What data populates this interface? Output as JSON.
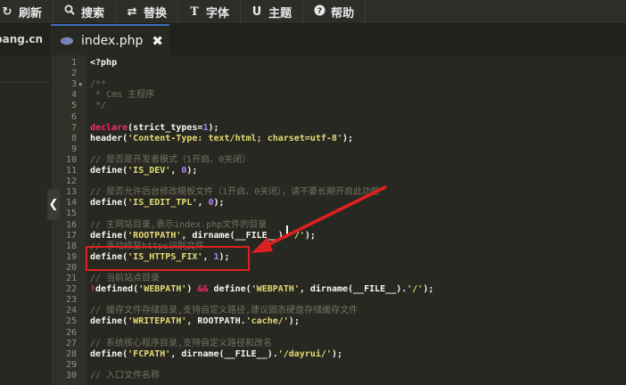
{
  "toolbar": {
    "refresh": "刷新",
    "search": "搜索",
    "replace": "替换",
    "font": "字体",
    "theme": "主题",
    "help": "帮助"
  },
  "tabs": {
    "side_label": "pang.cn",
    "file_name": "index.php",
    "close_glyph": "✖"
  },
  "sidebar": {
    "collapse_glyph": "❮"
  },
  "editor": {
    "lines": [
      {
        "n": "1",
        "fold": "",
        "parts": [
          {
            "t": "<?php",
            "c": "f"
          }
        ]
      },
      {
        "n": "2",
        "fold": "",
        "parts": []
      },
      {
        "n": "3",
        "fold": "▼",
        "parts": [
          {
            "t": "/**",
            "c": "c"
          }
        ]
      },
      {
        "n": "4",
        "fold": "",
        "parts": [
          {
            "t": " * Cms 主程序",
            "c": "c"
          }
        ]
      },
      {
        "n": "5",
        "fold": "",
        "parts": [
          {
            "t": " */",
            "c": "c"
          }
        ]
      },
      {
        "n": "6",
        "fold": "",
        "parts": []
      },
      {
        "n": "7",
        "fold": "",
        "parts": [
          {
            "t": "declare",
            "c": "k"
          },
          {
            "t": "(strict_types=",
            "c": "f"
          },
          {
            "t": "1",
            "c": "n"
          },
          {
            "t": ");",
            "c": "f"
          }
        ]
      },
      {
        "n": "8",
        "fold": "",
        "parts": [
          {
            "t": "header(",
            "c": "f"
          },
          {
            "t": "'Content-Type: text/html; charset=utf-8'",
            "c": "s"
          },
          {
            "t": ");",
            "c": "f"
          }
        ]
      },
      {
        "n": "9",
        "fold": "",
        "parts": []
      },
      {
        "n": "10",
        "fold": "",
        "parts": [
          {
            "t": "// 是否是开发者模式（1开启、0关闭）",
            "c": "c"
          }
        ]
      },
      {
        "n": "11",
        "fold": "",
        "parts": [
          {
            "t": "define(",
            "c": "f"
          },
          {
            "t": "'IS_DEV'",
            "c": "s"
          },
          {
            "t": ", ",
            "c": "f"
          },
          {
            "t": "0",
            "c": "n"
          },
          {
            "t": ");",
            "c": "f"
          }
        ]
      },
      {
        "n": "12",
        "fold": "",
        "parts": []
      },
      {
        "n": "13",
        "fold": "",
        "parts": [
          {
            "t": "// 是否允许后台修改模板文件（1开启、0关闭），请不要长期开启此功能",
            "c": "c"
          }
        ]
      },
      {
        "n": "14",
        "fold": "",
        "parts": [
          {
            "t": "define(",
            "c": "f"
          },
          {
            "t": "'IS_EDIT_TPL'",
            "c": "s"
          },
          {
            "t": ", ",
            "c": "f"
          },
          {
            "t": "0",
            "c": "n"
          },
          {
            "t": ");",
            "c": "f"
          }
        ]
      },
      {
        "n": "15",
        "fold": "",
        "parts": []
      },
      {
        "n": "16",
        "fold": "",
        "parts": [
          {
            "t": "// 主网站目录,表示index.php文件的目录",
            "c": "c"
          }
        ]
      },
      {
        "n": "17",
        "fold": "",
        "parts": [
          {
            "t": "define(",
            "c": "f"
          },
          {
            "t": "'ROOTPATH'",
            "c": "s"
          },
          {
            "t": ", dirname(__FILE__).",
            "c": "f"
          },
          {
            "t": "'/'",
            "c": "s"
          },
          {
            "t": ");",
            "c": "f"
          }
        ]
      },
      {
        "n": "18",
        "fold": "",
        "parts": [
          {
            "t": "// 手动修复https识别文件",
            "c": "c"
          }
        ]
      },
      {
        "n": "19",
        "fold": "",
        "parts": [
          {
            "t": "define(",
            "c": "f"
          },
          {
            "t": "'IS_HTTPS_FIX'",
            "c": "s"
          },
          {
            "t": ", ",
            "c": "f"
          },
          {
            "t": "1",
            "c": "n"
          },
          {
            "t": ");",
            "c": "f"
          }
        ]
      },
      {
        "n": "20",
        "fold": "",
        "parts": []
      },
      {
        "n": "21",
        "fold": "",
        "parts": [
          {
            "t": "// 当前站点目录",
            "c": "c"
          }
        ]
      },
      {
        "n": "22",
        "fold": "",
        "parts": [
          {
            "t": "!",
            "c": "k"
          },
          {
            "t": "defined(",
            "c": "f"
          },
          {
            "t": "'WEBPATH'",
            "c": "s"
          },
          {
            "t": ") ",
            "c": "f"
          },
          {
            "t": "&&",
            "c": "k"
          },
          {
            "t": " define(",
            "c": "f"
          },
          {
            "t": "'WEBPATH'",
            "c": "s"
          },
          {
            "t": ", dirname(__FILE__).",
            "c": "f"
          },
          {
            "t": "'/'",
            "c": "s"
          },
          {
            "t": ");",
            "c": "f"
          }
        ]
      },
      {
        "n": "23",
        "fold": "",
        "parts": []
      },
      {
        "n": "24",
        "fold": "",
        "parts": [
          {
            "t": "// 缓存文件存储目录,支持自定义路径,建议固态硬盘存储缓存文件",
            "c": "c"
          }
        ]
      },
      {
        "n": "25",
        "fold": "",
        "parts": [
          {
            "t": "define(",
            "c": "f"
          },
          {
            "t": "'WRITEPATH'",
            "c": "s"
          },
          {
            "t": ", ROOTPATH.",
            "c": "f"
          },
          {
            "t": "'cache/'",
            "c": "s"
          },
          {
            "t": ");",
            "c": "f"
          }
        ]
      },
      {
        "n": "26",
        "fold": "",
        "parts": []
      },
      {
        "n": "27",
        "fold": "",
        "parts": [
          {
            "t": "// 系统核心程序目录,支持自定义路径和改名",
            "c": "c"
          }
        ]
      },
      {
        "n": "28",
        "fold": "",
        "parts": [
          {
            "t": "define(",
            "c": "f"
          },
          {
            "t": "'FCPATH'",
            "c": "s"
          },
          {
            "t": ", dirname(__FILE__).",
            "c": "f"
          },
          {
            "t": "'/dayrui/'",
            "c": "s"
          },
          {
            "t": ");",
            "c": "f"
          }
        ]
      },
      {
        "n": "29",
        "fold": "",
        "parts": []
      },
      {
        "n": "30",
        "fold": "",
        "parts": [
          {
            "t": "// 入口文件名称",
            "c": "c"
          }
        ]
      }
    ]
  },
  "colors": {
    "annotation": "#e02020",
    "comment": "#75715e",
    "string": "#e6db74",
    "number": "#ae81ff",
    "keyword": "#f92672",
    "tab_accent": "#3c6cb4"
  }
}
